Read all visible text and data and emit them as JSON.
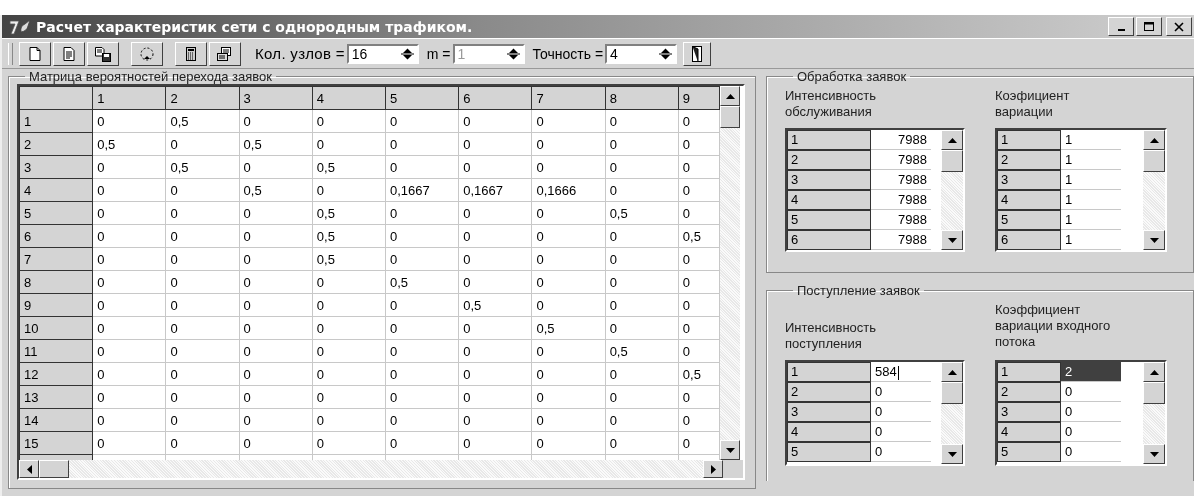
{
  "window": {
    "title": "Расчет характеристик сети с однородным трафиком."
  },
  "toolbar": {
    "buttons": [
      {
        "kind": "new"
      },
      {
        "kind": "open"
      },
      {
        "kind": "save"
      },
      {
        "kind": "cycle"
      },
      {
        "kind": "calculator"
      },
      {
        "kind": "print"
      }
    ],
    "nodes": {
      "label": "Кол. узлов =",
      "value": "16",
      "disabled": false
    },
    "m": {
      "label": "m =",
      "value": "1",
      "disabled": true
    },
    "precision": {
      "label": "Точность =",
      "value": "4",
      "disabled": false
    },
    "exit": {
      "kind": "door"
    }
  },
  "matrix": {
    "title": "Матрица вероятностей перехода заявок",
    "columns": [
      "1",
      "2",
      "3",
      "4",
      "5",
      "6",
      "7",
      "8",
      "9"
    ],
    "rows": [
      {
        "label": "1",
        "cells": [
          "0",
          "0,5",
          "0",
          "0",
          "0",
          "0",
          "0",
          "0",
          "0"
        ]
      },
      {
        "label": "2",
        "cells": [
          "0,5",
          "0",
          "0,5",
          "0",
          "0",
          "0",
          "0",
          "0",
          "0"
        ]
      },
      {
        "label": "3",
        "cells": [
          "0",
          "0,5",
          "0",
          "0,5",
          "0",
          "0",
          "0",
          "0",
          "0"
        ]
      },
      {
        "label": "4",
        "cells": [
          "0",
          "0",
          "0,5",
          "0",
          "0,1667",
          "0,1667",
          "0,1666",
          "0",
          "0"
        ]
      },
      {
        "label": "5",
        "cells": [
          "0",
          "0",
          "0",
          "0,5",
          "0",
          "0",
          "0",
          "0,5",
          "0"
        ]
      },
      {
        "label": "6",
        "cells": [
          "0",
          "0",
          "0",
          "0,5",
          "0",
          "0",
          "0",
          "0",
          "0,5"
        ]
      },
      {
        "label": "7",
        "cells": [
          "0",
          "0",
          "0",
          "0,5",
          "0",
          "0",
          "0",
          "0",
          "0"
        ]
      },
      {
        "label": "8",
        "cells": [
          "0",
          "0",
          "0",
          "0",
          "0,5",
          "0",
          "0",
          "0",
          "0"
        ]
      },
      {
        "label": "9",
        "cells": [
          "0",
          "0",
          "0",
          "0",
          "0",
          "0,5",
          "0",
          "0",
          "0"
        ]
      },
      {
        "label": "10",
        "cells": [
          "0",
          "0",
          "0",
          "0",
          "0",
          "0",
          "0,5",
          "0",
          "0"
        ]
      },
      {
        "label": "11",
        "cells": [
          "0",
          "0",
          "0",
          "0",
          "0",
          "0",
          "0",
          "0,5",
          "0"
        ]
      },
      {
        "label": "12",
        "cells": [
          "0",
          "0",
          "0",
          "0",
          "0",
          "0",
          "0",
          "0",
          "0,5"
        ]
      },
      {
        "label": "13",
        "cells": [
          "0",
          "0",
          "0",
          "0",
          "0",
          "0",
          "0",
          "0",
          "0"
        ]
      },
      {
        "label": "14",
        "cells": [
          "0",
          "0",
          "0",
          "0",
          "0",
          "0",
          "0",
          "0",
          "0"
        ]
      },
      {
        "label": "15",
        "cells": [
          "0",
          "0",
          "0",
          "0",
          "0",
          "0",
          "0",
          "0",
          "0"
        ]
      }
    ]
  },
  "processing": {
    "title": "Обработка заявок",
    "lists": [
      {
        "heading": "Интенсивность обслуживания",
        "rows": [
          {
            "label": "1",
            "value": "7988",
            "selected": false,
            "editing": false
          },
          {
            "label": "2",
            "value": "7988",
            "selected": false,
            "editing": false
          },
          {
            "label": "3",
            "value": "7988",
            "selected": false,
            "editing": false
          },
          {
            "label": "4",
            "value": "7988",
            "selected": false,
            "editing": false
          },
          {
            "label": "5",
            "value": "7988",
            "selected": false,
            "editing": false
          },
          {
            "label": "6",
            "value": "7988",
            "selected": false,
            "editing": false
          }
        ]
      },
      {
        "heading": "Коэфициент вариации",
        "rows": [
          {
            "label": "1",
            "value": "1",
            "selected": false,
            "editing": false
          },
          {
            "label": "2",
            "value": "1",
            "selected": false,
            "editing": false
          },
          {
            "label": "3",
            "value": "1",
            "selected": false,
            "editing": false
          },
          {
            "label": "4",
            "value": "1",
            "selected": false,
            "editing": false
          },
          {
            "label": "5",
            "value": "1",
            "selected": false,
            "editing": false
          },
          {
            "label": "6",
            "value": "1",
            "selected": false,
            "editing": false
          }
        ]
      }
    ]
  },
  "arrival": {
    "title": "Поступление заявок",
    "lists": [
      {
        "heading": "Интенсивность поступления",
        "rows": [
          {
            "label": "1",
            "value": "584",
            "selected": false,
            "editing": true
          },
          {
            "label": "2",
            "value": "0",
            "selected": false,
            "editing": false
          },
          {
            "label": "3",
            "value": "0",
            "selected": false,
            "editing": false
          },
          {
            "label": "4",
            "value": "0",
            "selected": false,
            "editing": false
          },
          {
            "label": "5",
            "value": "0",
            "selected": false,
            "editing": false
          }
        ]
      },
      {
        "heading": "Коэффициент вариации входного потока",
        "rows": [
          {
            "label": "1",
            "value": "2",
            "selected": true,
            "editing": false
          },
          {
            "label": "2",
            "value": "0",
            "selected": false,
            "editing": false
          },
          {
            "label": "3",
            "value": "0",
            "selected": false,
            "editing": false
          },
          {
            "label": "4",
            "value": "0",
            "selected": false,
            "editing": false
          },
          {
            "label": "5",
            "value": "0",
            "selected": false,
            "editing": false
          }
        ]
      }
    ]
  }
}
